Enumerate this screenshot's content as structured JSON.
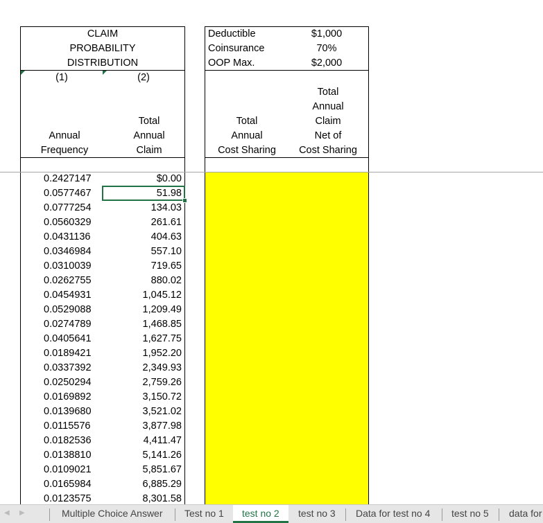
{
  "distribution_header": {
    "title_lines": [
      "CLAIM",
      "PROBABILITY",
      "DISTRIBUTION"
    ],
    "col1_number": "(1)",
    "col2_number": "(2)",
    "col1_label_lines": [
      "Annual",
      "Frequency"
    ],
    "col2_label_lines": [
      "Total",
      "Annual",
      "Claim"
    ]
  },
  "plan_parameters": [
    {
      "label": "Deductible",
      "value": "$1,000"
    },
    {
      "label": "Coinsurance",
      "value": "70%"
    },
    {
      "label": "OOP Max.",
      "value": "$2,000"
    }
  ],
  "cost_sharing_header": {
    "col3_label_lines": [
      "Total",
      "Annual",
      "Cost Sharing"
    ],
    "col4_label_lines": [
      "Total",
      "Annual",
      "Claim",
      "Net of",
      "Cost Sharing"
    ]
  },
  "rows": [
    {
      "frequency": "0.2427147",
      "claim": "$0.00"
    },
    {
      "frequency": "0.0577467",
      "claim": "51.98"
    },
    {
      "frequency": "0.0777254",
      "claim": "134.03"
    },
    {
      "frequency": "0.0560329",
      "claim": "261.61"
    },
    {
      "frequency": "0.0431136",
      "claim": "404.63"
    },
    {
      "frequency": "0.0346984",
      "claim": "557.10"
    },
    {
      "frequency": "0.0310039",
      "claim": "719.65"
    },
    {
      "frequency": "0.0262755",
      "claim": "880.02"
    },
    {
      "frequency": "0.0454931",
      "claim": "1,045.12"
    },
    {
      "frequency": "0.0529088",
      "claim": "1,209.49"
    },
    {
      "frequency": "0.0274789",
      "claim": "1,468.85"
    },
    {
      "frequency": "0.0405641",
      "claim": "1,627.75"
    },
    {
      "frequency": "0.0189421",
      "claim": "1,952.20"
    },
    {
      "frequency": "0.0337392",
      "claim": "2,349.93"
    },
    {
      "frequency": "0.0250294",
      "claim": "2,759.26"
    },
    {
      "frequency": "0.0169892",
      "claim": "3,150.72"
    },
    {
      "frequency": "0.0139680",
      "claim": "3,521.02"
    },
    {
      "frequency": "0.0115576",
      "claim": "3,877.98"
    },
    {
      "frequency": "0.0182536",
      "claim": "4,411.47"
    },
    {
      "frequency": "0.0138810",
      "claim": "5,141.26"
    },
    {
      "frequency": "0.0109021",
      "claim": "5,851.67"
    },
    {
      "frequency": "0.0165984",
      "claim": "6,885.29"
    },
    {
      "frequency": "0.0123575",
      "claim": "8,301.58"
    }
  ],
  "selected_row_index": 1,
  "fill_color": "#ffff00",
  "accent_color": "#217346",
  "sheet_tabs": [
    {
      "label": "Multiple Choice Answer",
      "active": false
    },
    {
      "label": "Test no 1",
      "active": false
    },
    {
      "label": "test no 2",
      "active": true
    },
    {
      "label": "test no 3",
      "active": false
    },
    {
      "label": "Data for test no 4",
      "active": false
    },
    {
      "label": "test no 5",
      "active": false
    },
    {
      "label": "data for",
      "active": false
    }
  ],
  "nav_icons": [
    "scroll-left-icon",
    "scroll-right-icon"
  ]
}
